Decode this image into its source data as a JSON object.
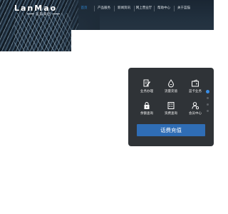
{
  "brand": {
    "name": "LanMao",
    "subtitle": "蓝猫集团"
  },
  "nav": {
    "items": [
      {
        "label": "首页",
        "active": true
      },
      {
        "label": "产品服务",
        "active": false
      },
      {
        "label": "新闻资讯",
        "active": false
      },
      {
        "label": "网上营业厅",
        "active": false
      },
      {
        "label": "帮助中心",
        "active": false
      },
      {
        "label": "关于蓝猫",
        "active": false
      }
    ],
    "active_color": "#2f8fe0"
  },
  "quick_panel": {
    "items": [
      {
        "label": "业务办理",
        "icon": "edit-document-icon"
      },
      {
        "label": "流量充值",
        "icon": "traffic-drop-icon"
      },
      {
        "label": "蓝卡业务",
        "icon": "card-icon"
      },
      {
        "label": "余额查询",
        "icon": "wallet-lock-icon"
      },
      {
        "label": "资费查询",
        "icon": "list-document-icon"
      },
      {
        "label": "会员中心",
        "icon": "member-person-icon"
      }
    ],
    "cta_label": "话费充值",
    "cta_color": "#2f6db5",
    "background_color": "#2f3337"
  },
  "slider": {
    "count": 4,
    "active_index": 0
  }
}
